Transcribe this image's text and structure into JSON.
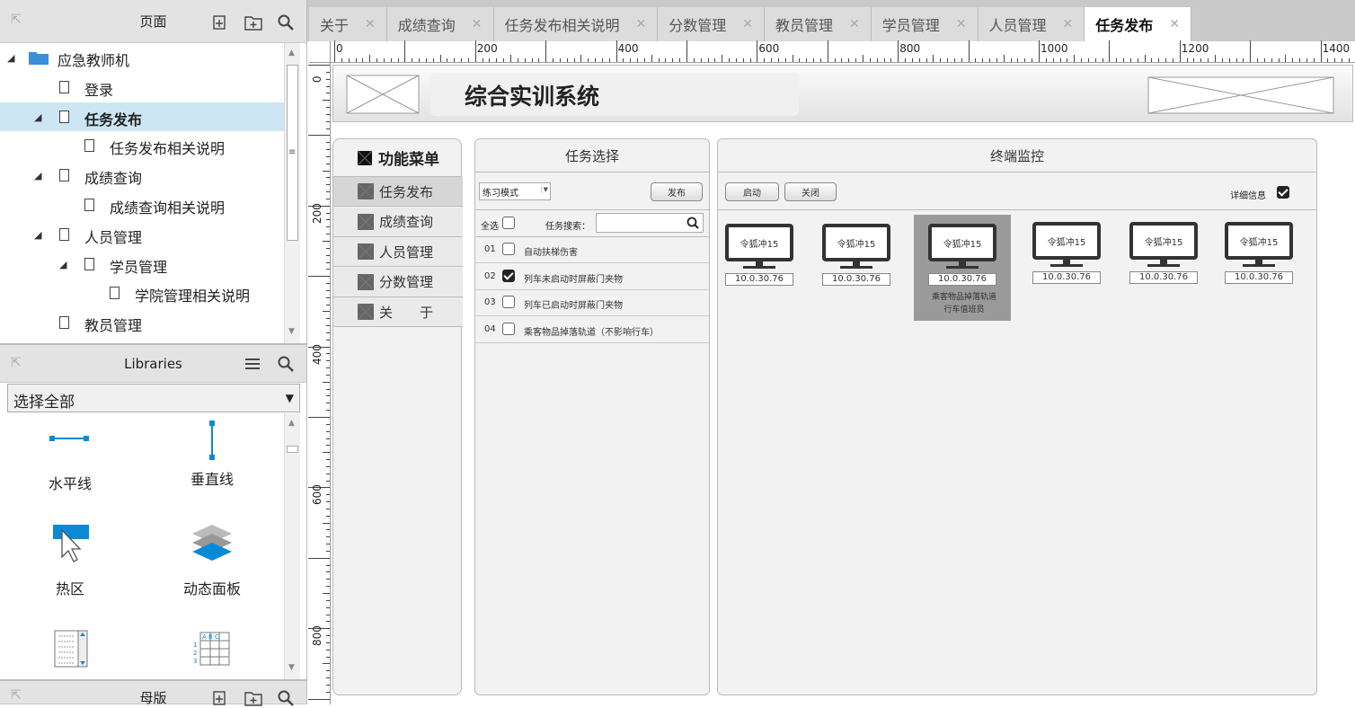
{
  "pages_panel": {
    "title": "页面",
    "tree": [
      {
        "label": "应急教师机",
        "type": "folder"
      },
      {
        "label": "登录",
        "type": "page"
      },
      {
        "label": "任务发布",
        "type": "page",
        "selected": true
      },
      {
        "label": "任务发布相关说明",
        "type": "page"
      },
      {
        "label": "成绩查询",
        "type": "page"
      },
      {
        "label": "成绩查询相关说明",
        "type": "page"
      },
      {
        "label": "人员管理",
        "type": "page"
      },
      {
        "label": "学员管理",
        "type": "page"
      },
      {
        "label": "学院管理相关说明",
        "type": "page"
      },
      {
        "label": "教员管理",
        "type": "page"
      }
    ]
  },
  "libraries_panel": {
    "title": "Libraries",
    "selected": "选择全部",
    "items": [
      "水平线",
      "垂直线",
      "热区",
      "动态面板",
      "",
      ""
    ]
  },
  "masters_panel": {
    "title": "母版"
  },
  "tabs": [
    "关于",
    "成绩查询",
    "任务发布相关说明",
    "分数管理",
    "教员管理",
    "学员管理",
    "人员管理",
    "任务发布"
  ],
  "active_tab": "任务发布",
  "ruler_h": [
    "0",
    "200",
    "400",
    "600",
    "800",
    "1000",
    "1200",
    "1400"
  ],
  "ruler_v": [
    "0",
    "200",
    "400",
    "600",
    "800"
  ],
  "design": {
    "system_title": "综合实训系统",
    "menu": {
      "title": "功能菜单",
      "items": [
        "任务发布",
        "成绩查询",
        "人员管理",
        "分数管理",
        "关　　于"
      ]
    },
    "task": {
      "title": "任务选择",
      "mode": "练习模式",
      "publish": "发布",
      "select_all": "全选",
      "search_label": "任务搜索：",
      "rows": [
        {
          "num": "01",
          "text": "自动扶梯伤害",
          "checked": false
        },
        {
          "num": "02",
          "text": "列车未启动时屏蔽门夹物",
          "checked": true
        },
        {
          "num": "03",
          "text": "列车已启动时屏蔽门夹物",
          "checked": false
        },
        {
          "num": "04",
          "text": "乘客物品掉落轨道（不影响行车）",
          "checked": false
        }
      ]
    },
    "monitor": {
      "title": "终端监控",
      "start": "启动",
      "close": "关闭",
      "detail": "详细信息",
      "terminals": [
        {
          "label": "令狐冲15",
          "ip": "10.0.30.76"
        },
        {
          "label": "令狐冲15",
          "ip": "10.0.30.76"
        },
        {
          "label": "令狐冲15",
          "ip": "10.0.30.76",
          "note": "乘客物品掉落轨道",
          "note2": "行车值班员",
          "selected": true
        },
        {
          "label": "令狐冲15",
          "ip": "10.0.30.76"
        },
        {
          "label": "令狐冲15",
          "ip": "10.0.30.76"
        },
        {
          "label": "令狐冲15",
          "ip": "10.0.30.76"
        }
      ]
    }
  }
}
